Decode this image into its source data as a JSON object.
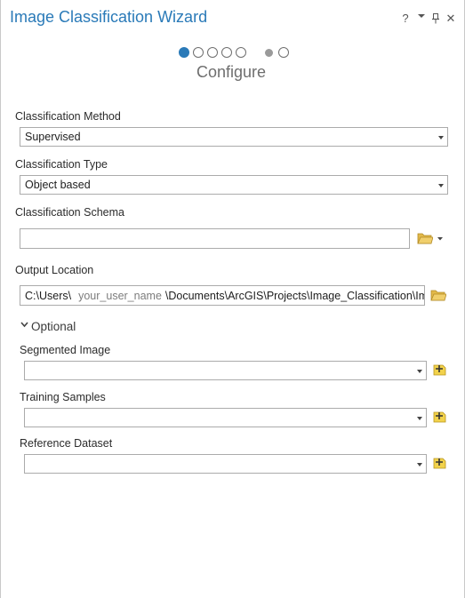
{
  "header": {
    "title": "Image Classification Wizard",
    "help_label": "?",
    "close_label": "✕"
  },
  "wizard": {
    "step_count": 7,
    "current_step": 1,
    "step_title": "Configure"
  },
  "fields": {
    "classification_method": {
      "label": "Classification Method",
      "value": "Supervised"
    },
    "classification_type": {
      "label": "Classification Type",
      "value": "Object based"
    },
    "classification_schema": {
      "label": "Classification Schema",
      "value": ""
    },
    "output_location": {
      "label": "Output Location",
      "value_prefix": "C:\\Users\\",
      "value_user": "your_user_name",
      "value_suffix": "\\Documents\\ArcGIS\\Projects\\Image_Classification\\Ima"
    }
  },
  "optional": {
    "label": "Optional",
    "segmented_image": {
      "label": "Segmented Image",
      "value": ""
    },
    "training_samples": {
      "label": "Training Samples",
      "value": ""
    },
    "reference_dataset": {
      "label": "Reference Dataset",
      "value": ""
    }
  },
  "colors": {
    "accent": "#2a7ab8",
    "folder_icon": "#e2b94a",
    "add_icon": "#f2d24b"
  }
}
